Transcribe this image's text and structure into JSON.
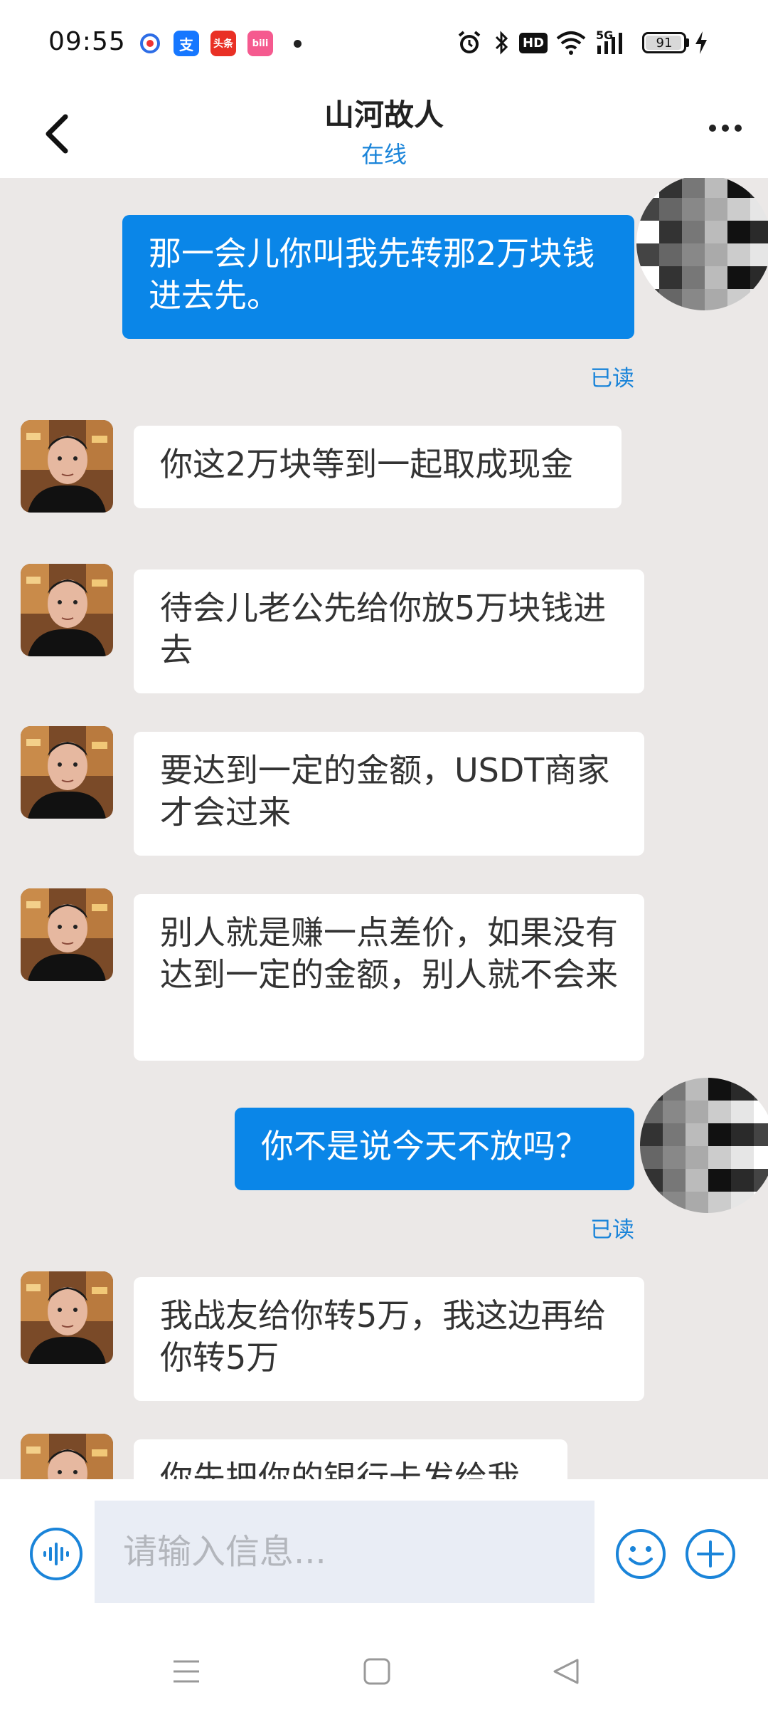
{
  "status_bar": {
    "time": "09:55",
    "app_icons": [
      {
        "name": "baidu-app-icon",
        "color": "#ffffff"
      },
      {
        "name": "alipay-app-icon",
        "label": "支",
        "color": "#1677ff"
      },
      {
        "name": "toutiao-app-icon",
        "label": "头条",
        "color": "#e93025"
      },
      {
        "name": "bilibili-app-icon",
        "label": "bili",
        "color": "#f55a8f"
      }
    ],
    "hd_label": "HD",
    "network_label": "5G",
    "battery": "91"
  },
  "header": {
    "title": "山河故人",
    "status": "在线"
  },
  "messages": [
    {
      "side": "out",
      "text": "那一会儿你叫我先转那2万块钱进去先。",
      "read": "已读"
    },
    {
      "side": "in",
      "text": "你这2万块等到一起取成现金"
    },
    {
      "side": "in",
      "text": "待会儿老公先给你放5万块钱进去"
    },
    {
      "side": "in",
      "text": "要达到一定的金额，USDT商家才会过来"
    },
    {
      "side": "in",
      "text": "别人就是赚一点差价，如果没有达到一定的金额，别人就不会来"
    },
    {
      "side": "out",
      "text": "你不是说今天不放吗？",
      "read": "已读"
    },
    {
      "side": "in",
      "text": "我战友给你转5万，我这边再给你转5万"
    },
    {
      "side": "in",
      "text": "你先把你的银行卡发给我"
    }
  ],
  "input": {
    "placeholder": "请输入信息..."
  },
  "colors": {
    "accent": "#1a84d9",
    "outgoing_bubble": "#0a86e8",
    "chat_background": "#ebe8e7"
  }
}
